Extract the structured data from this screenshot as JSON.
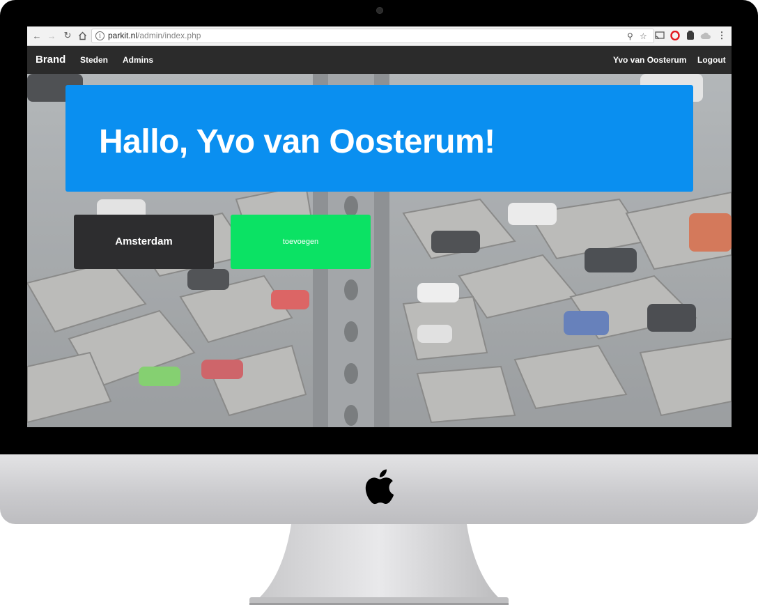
{
  "browser": {
    "url_host": "parkit.nl",
    "url_path": "/admin/index.php",
    "icons": [
      "back-icon",
      "forward-icon",
      "reload-icon",
      "home-icon",
      "info-icon",
      "key-icon",
      "star-icon",
      "cast-icon",
      "opera-icon",
      "extension-icon",
      "cloud-icon",
      "menu-icon"
    ]
  },
  "navbar": {
    "brand": "Brand",
    "links": [
      "Steden",
      "Admins"
    ],
    "user": "Yvo van Oosterum",
    "logout": "Logout"
  },
  "main": {
    "greeting": "Hallo, Yvo van Oosterum!",
    "city_card": "Amsterdam",
    "add_card": "toevoegen"
  },
  "colors": {
    "jumbotron": "#0a8ff0",
    "city_card": "#2d2d2f",
    "add_card": "#0be264",
    "navbar": "#2b2b2b"
  },
  "device": {
    "logo": "apple-logo"
  }
}
